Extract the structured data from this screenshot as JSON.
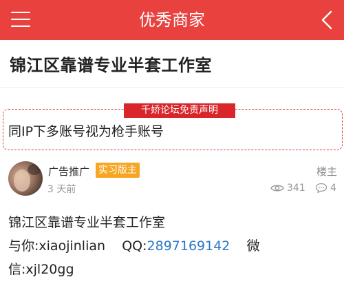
{
  "header": {
    "title": "优秀商家",
    "bg_color": "#e8413e"
  },
  "thread": {
    "title": "锦江区靠谱专业半套工作室"
  },
  "disclaimer": {
    "tag": "千娇论坛免责声明",
    "text": "同IP下多账号视为枪手账号",
    "border_color": "#d23a35"
  },
  "post": {
    "author": "广告推广",
    "role_badge": "实习版主",
    "badge_color": "#f6a623",
    "time": "3 天前",
    "floor": "楼主",
    "views": "341",
    "replies": "4",
    "body": {
      "line1": "锦江区靠谱专业半套工作室",
      "line2_prefix": "与你:xiaojinlian    QQ:",
      "qq_number": "2897169142",
      "line2_suffix": "    微",
      "line3": "信:xjl20gg"
    }
  },
  "icons": {
    "menu": "menu-icon",
    "back": "back-chevron-icon",
    "views": "eye-icon",
    "replies": "chat-bubble-icon"
  }
}
